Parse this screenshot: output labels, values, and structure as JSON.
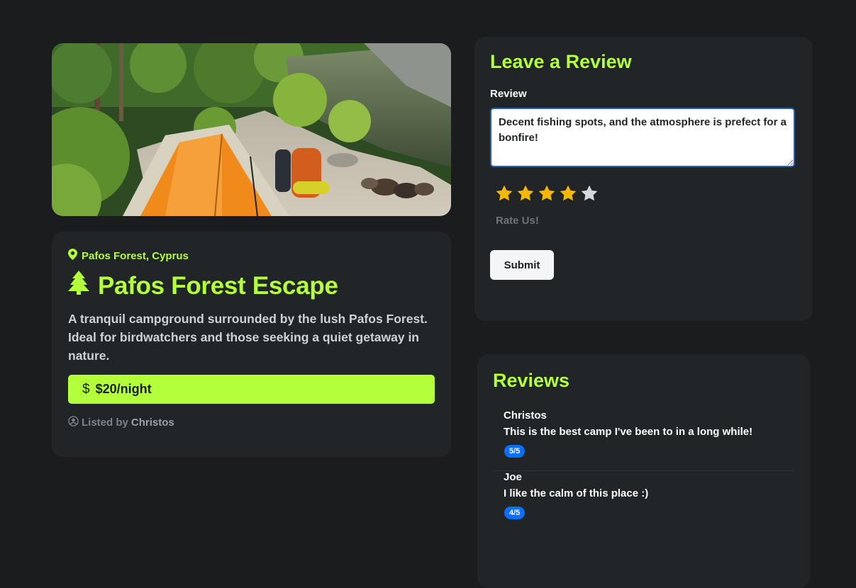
{
  "campground": {
    "location": "Pafos Forest, Cyprus",
    "title": "Pafos Forest Escape",
    "description": "A tranquil campground surrounded by the lush Pafos Forest. Ideal for birdwatchers and those seeking a quiet getaway in nature.",
    "price_symbol": "$",
    "price": "$20/night",
    "listed_prefix": "Listed by",
    "owner": "Christos"
  },
  "review_form": {
    "heading": "Leave a Review",
    "label": "Review",
    "text": "Decent fishing spots, and the atmosphere is prefect for a bonfire!",
    "rating": 4,
    "max_rating": 5,
    "rate_label": "Rate Us!",
    "submit_label": "Submit"
  },
  "reviews": {
    "heading": "Reviews",
    "items": [
      {
        "author": "Christos",
        "text": "This is the best camp I've been to in a long while!",
        "rating": "5/5"
      },
      {
        "author": "Joe",
        "text": "I like the calm of this place :)",
        "rating": "4/5"
      }
    ]
  },
  "colors": {
    "background": "#1b1c1e",
    "card": "#222528",
    "accent": "#b3ff3c",
    "badge": "#0d6efd",
    "star_filled": "#f5b800",
    "star_empty": "#d6d8db"
  },
  "icons": {
    "location": "map-pin-icon",
    "title": "tree-icon",
    "price": "dollar-icon",
    "owner": "user-circle-icon",
    "rating": "star-icon"
  }
}
